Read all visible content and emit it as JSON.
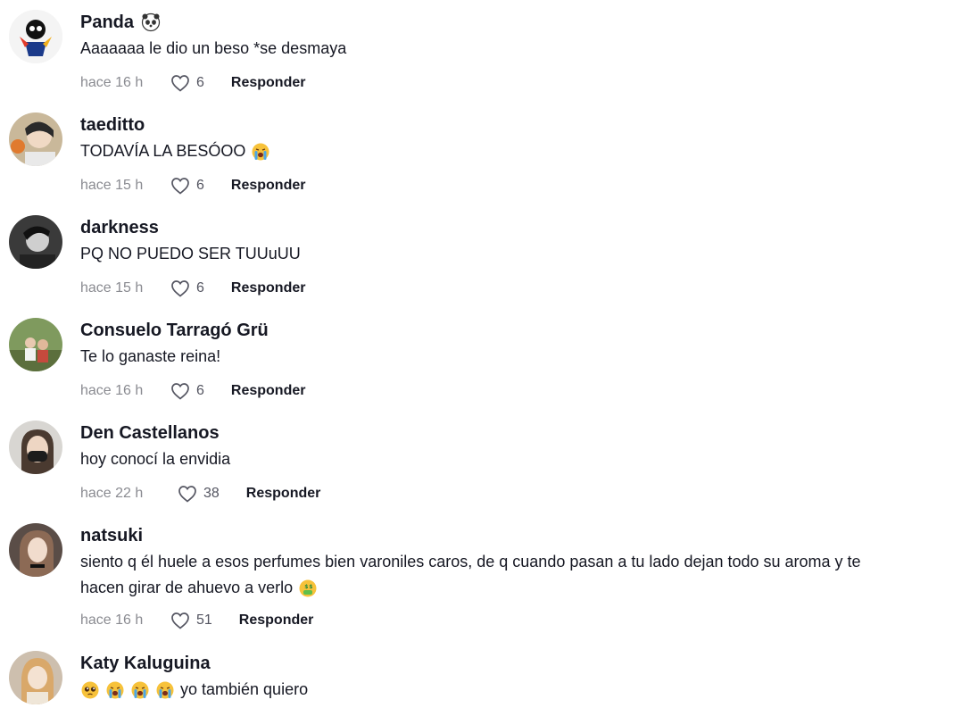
{
  "reply_label": "Responder",
  "comments": [
    {
      "name": "Panda",
      "name_emoji": "panda-emoji",
      "text": "Aaaaaaa le dio un beso *se desmaya",
      "time": "hace 16 h",
      "likes": "6"
    },
    {
      "name": "taeditto",
      "text": "TODAVÍA LA BESÓOO",
      "text_emoji": "crying-face-emoji",
      "time": "hace 15 h",
      "likes": "6"
    },
    {
      "name": "darkness",
      "text": "PQ NO PUEDO SER TUUuUU",
      "time": "hace 15 h",
      "likes": "6"
    },
    {
      "name": "Consuelo Tarragó Grü",
      "text": "Te lo ganaste reina!",
      "time": "hace 16 h",
      "likes": "6"
    },
    {
      "name": "Den Castellanos",
      "text": "hoy conocí la envidia",
      "time": "hace 22 h",
      "likes": "38"
    },
    {
      "name": "natsuki",
      "text_line1": "siento q él huele a esos perfumes bien varoniles caros, de q cuando pasan a tu lado dejan todo su aroma y te",
      "text_line2": "hacen girar de ahuevo a verlo",
      "text_emoji": "money-mouth-face-emoji",
      "time": "hace 16 h",
      "likes": "51"
    },
    {
      "name": "Katy Kaluguina",
      "text": "yo también quiero",
      "text_emojis": [
        "pleading-face-emoji",
        "crying-face-emoji",
        "crying-face-emoji",
        "crying-face-emoji"
      ]
    }
  ],
  "colors": {
    "text": "#161823",
    "meta": "#8a8b91",
    "background": "#ffffff"
  }
}
